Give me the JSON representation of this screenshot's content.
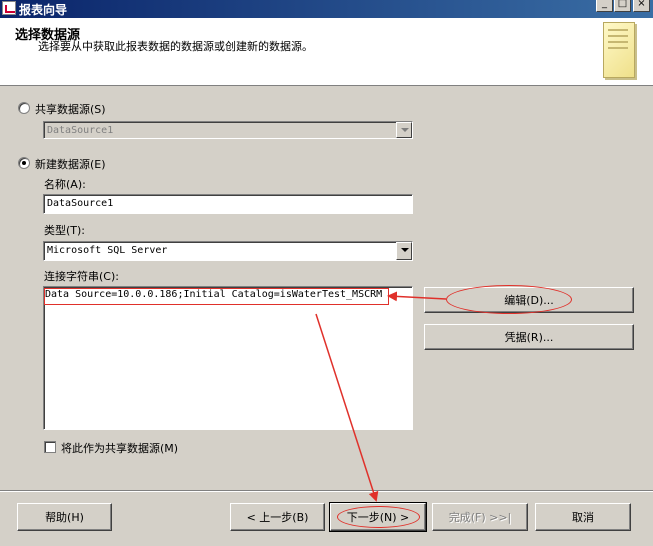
{
  "window": {
    "title": "报表向导",
    "minimize_glyph": "_",
    "maximize_glyph": "□",
    "close_glyph": "×"
  },
  "header": {
    "title": "选择数据源",
    "subtitle": "选择要从中获取此报表数据的数据源或创建新的数据源。",
    "icon": "report-document-icon"
  },
  "shared": {
    "radio_label": "共享数据源(S)",
    "selected": false,
    "dropdown_value": "DataSource1"
  },
  "new_source": {
    "radio_label": "新建数据源(E)",
    "selected": true,
    "name_label": "名称(A):",
    "name_value": "DataSource1",
    "type_label": "类型(T):",
    "type_value": "Microsoft SQL Server",
    "connection_label": "连接字符串(C):",
    "connection_value": "Data Source=10.0.0.186;Initial Catalog=isWaterTest_MSCRM",
    "edit_button": "编辑(D)...",
    "credentials_button": "凭据(R)...",
    "make_shared_label": "将此作为共享数据源(M)",
    "make_shared_checked": false
  },
  "footer": {
    "help": "帮助(H)",
    "back": "< 上一步(B)",
    "next": "下一步(N) >",
    "finish": "完成(F) >>|",
    "cancel": "取消"
  },
  "colors": {
    "annotation": "#e0302a",
    "titlebar": "#0a246a",
    "face": "#d4d0c8"
  }
}
